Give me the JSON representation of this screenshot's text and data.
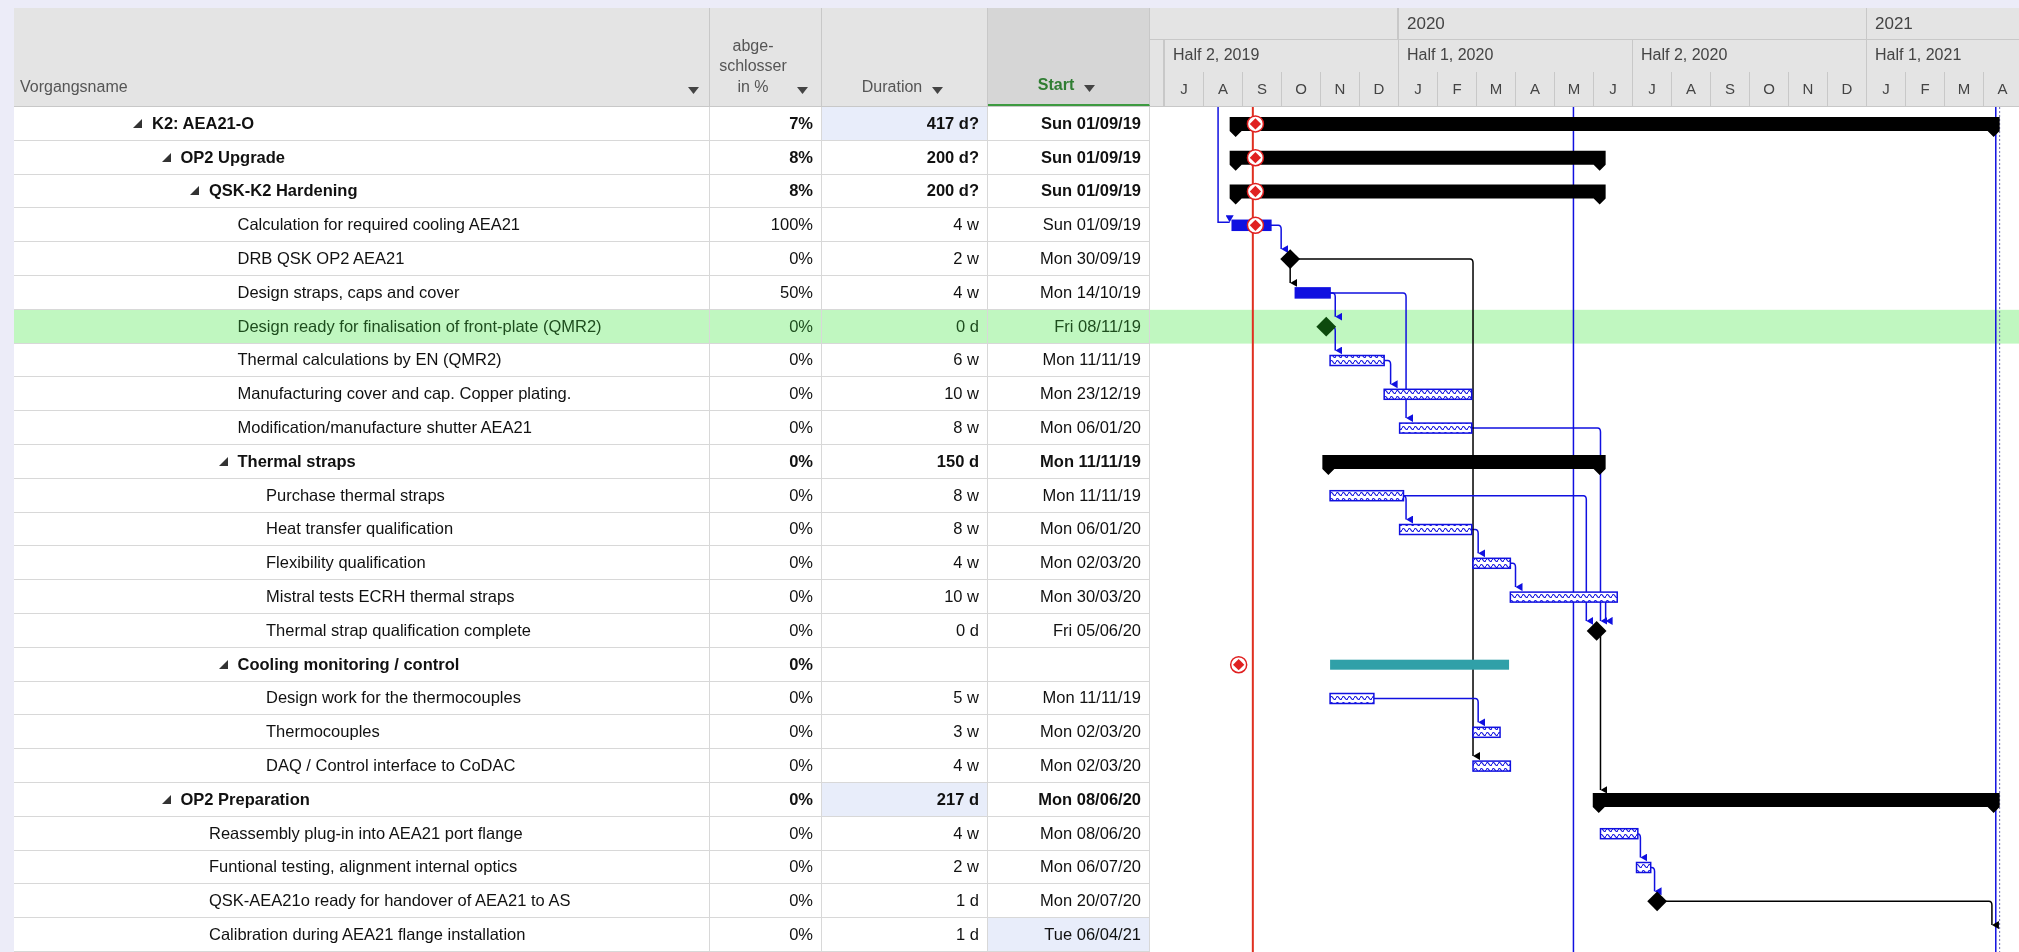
{
  "columns": [
    {
      "lines": [
        "Vorgangsname"
      ],
      "selected": false
    },
    {
      "lines": [
        "abge-",
        "schlosser",
        "in %"
      ],
      "selected": false
    },
    {
      "lines": [
        "Duration"
      ],
      "selected": false
    },
    {
      "lines": [
        "Start"
      ],
      "selected": true
    }
  ],
  "timescale": {
    "years": [
      "2020",
      "2021"
    ],
    "halves": [
      "Half 2, 2019",
      "Half 1, 2020",
      "Half 2, 2020",
      "Half 1, 2021"
    ],
    "months": [
      "J",
      "A",
      "S",
      "O",
      "N",
      "D",
      "J",
      "F",
      "M",
      "A",
      "M",
      "J",
      "J",
      "A",
      "S",
      "O",
      "N",
      "D",
      "J",
      "F",
      "M",
      "A"
    ]
  },
  "rows": [
    {
      "name": "K2: AEA21-O",
      "kind": "summary",
      "expanded": true,
      "pct": "7%",
      "duration": "417 d?",
      "start": "Sun 01/09/19",
      "selected": false,
      "duration_highlighted": true,
      "children": [
        {
          "name": "OP2 Upgrade",
          "kind": "summary",
          "expanded": true,
          "pct": "8%",
          "duration": "200 d?",
          "start": "Sun 01/09/19",
          "selected": false,
          "children": [
            {
              "name": "QSK-K2 Hardening",
              "kind": "summary",
              "expanded": true,
              "pct": "8%",
              "duration": "200 d?",
              "start": "Sun 01/09/19",
              "selected": false,
              "children": [
                {
                  "name": "Calculation for required cooling AEA21",
                  "kind": "task",
                  "pct": "100%",
                  "duration": "4 w",
                  "start": "Sun 01/09/19",
                  "selected": false
                },
                {
                  "name": "DRB QSK OP2 AEA21",
                  "kind": "task",
                  "pct": "0%",
                  "duration": "2 w",
                  "start": "Mon 30/09/19",
                  "selected": false
                },
                {
                  "name": "Design straps, caps and cover",
                  "kind": "task",
                  "pct": "50%",
                  "duration": "4 w",
                  "start": "Mon 14/10/19",
                  "selected": false
                },
                {
                  "name": "Design ready for finalisation of front-plate (QMR2)",
                  "kind": "task",
                  "pct": "0%",
                  "duration": "0 d",
                  "start": "Fri 08/11/19",
                  "selected": true
                },
                {
                  "name": "Thermal calculations by EN (QMR2)",
                  "kind": "task",
                  "pct": "0%",
                  "duration": "6 w",
                  "start": "Mon 11/11/19",
                  "selected": false
                },
                {
                  "name": "Manufacturing cover and cap. Copper plating.",
                  "kind": "task",
                  "pct": "0%",
                  "duration": "10 w",
                  "start": "Mon 23/12/19",
                  "selected": false
                },
                {
                  "name": "Modification/manufacture shutter AEA21",
                  "kind": "task",
                  "pct": "0%",
                  "duration": "8 w",
                  "start": "Mon 06/01/20",
                  "selected": false
                },
                {
                  "name": "Thermal straps",
                  "kind": "summary",
                  "expanded": true,
                  "pct": "0%",
                  "duration": "150 d",
                  "start": "Mon 11/11/19",
                  "selected": false,
                  "children": [
                    {
                      "name": "Purchase thermal straps",
                      "kind": "task",
                      "pct": "0%",
                      "duration": "8 w",
                      "start": "Mon 11/11/19",
                      "selected": false
                    },
                    {
                      "name": "Heat transfer qualification",
                      "kind": "task",
                      "pct": "0%",
                      "duration": "8 w",
                      "start": "Mon 06/01/20",
                      "selected": false
                    },
                    {
                      "name": "Flexibility qualification",
                      "kind": "task",
                      "pct": "0%",
                      "duration": "4 w",
                      "start": "Mon 02/03/20",
                      "selected": false
                    },
                    {
                      "name": "Mistral tests ECRH thermal straps",
                      "kind": "task",
                      "pct": "0%",
                      "duration": "10 w",
                      "start": "Mon 30/03/20",
                      "selected": false
                    },
                    {
                      "name": "Thermal strap qualification complete",
                      "kind": "task",
                      "pct": "0%",
                      "duration": "0 d",
                      "start": "Fri 05/06/20",
                      "selected": false
                    }
                  ]
                },
                {
                  "name": "Cooling monitoring / control",
                  "kind": "summary",
                  "expanded": true,
                  "pct": "0%",
                  "selected": false,
                  "children": [
                    {
                      "name": "Design work for the thermocouples",
                      "kind": "task",
                      "pct": "0%",
                      "duration": "5 w",
                      "start": "Mon 11/11/19",
                      "selected": false
                    },
                    {
                      "name": "Thermocouples",
                      "kind": "task",
                      "pct": "0%",
                      "duration": "3 w",
                      "start": "Mon 02/03/20",
                      "selected": false
                    },
                    {
                      "name": "DAQ / Control interface to CoDAC",
                      "kind": "task",
                      "pct": "0%",
                      "duration": "4 w",
                      "start": "Mon 02/03/20",
                      "selected": false
                    }
                  ]
                }
              ]
            }
          ]
        },
        {
          "name": "OP2 Preparation",
          "kind": "summary",
          "expanded": true,
          "pct": "0%",
          "duration": "217 d",
          "start": "Mon 08/06/20",
          "selected": false,
          "duration_highlighted": true,
          "children": [
            {
              "name": "Reassembly plug-in into AEA21 port flange",
              "kind": "task",
              "pct": "0%",
              "duration": "4 w",
              "start": "Mon 08/06/20",
              "selected": false
            },
            {
              "name": "Funtional testing, alignment internal optics",
              "kind": "task",
              "pct": "0%",
              "duration": "2 w",
              "start": "Mon 06/07/20",
              "selected": false
            },
            {
              "name": "QSK-AEA21o ready for handover of AEA21 to AS",
              "kind": "task",
              "pct": "0%",
              "duration": "1 d",
              "start": "Mon 20/07/20",
              "selected": false
            },
            {
              "name": "Calibration during AEA21 flange installation",
              "kind": "task",
              "pct": "0%",
              "duration": "1 d",
              "start": "Tue 06/04/21",
              "selected": false,
              "start_highlighted": true
            }
          ]
        }
      ]
    }
  ]
}
